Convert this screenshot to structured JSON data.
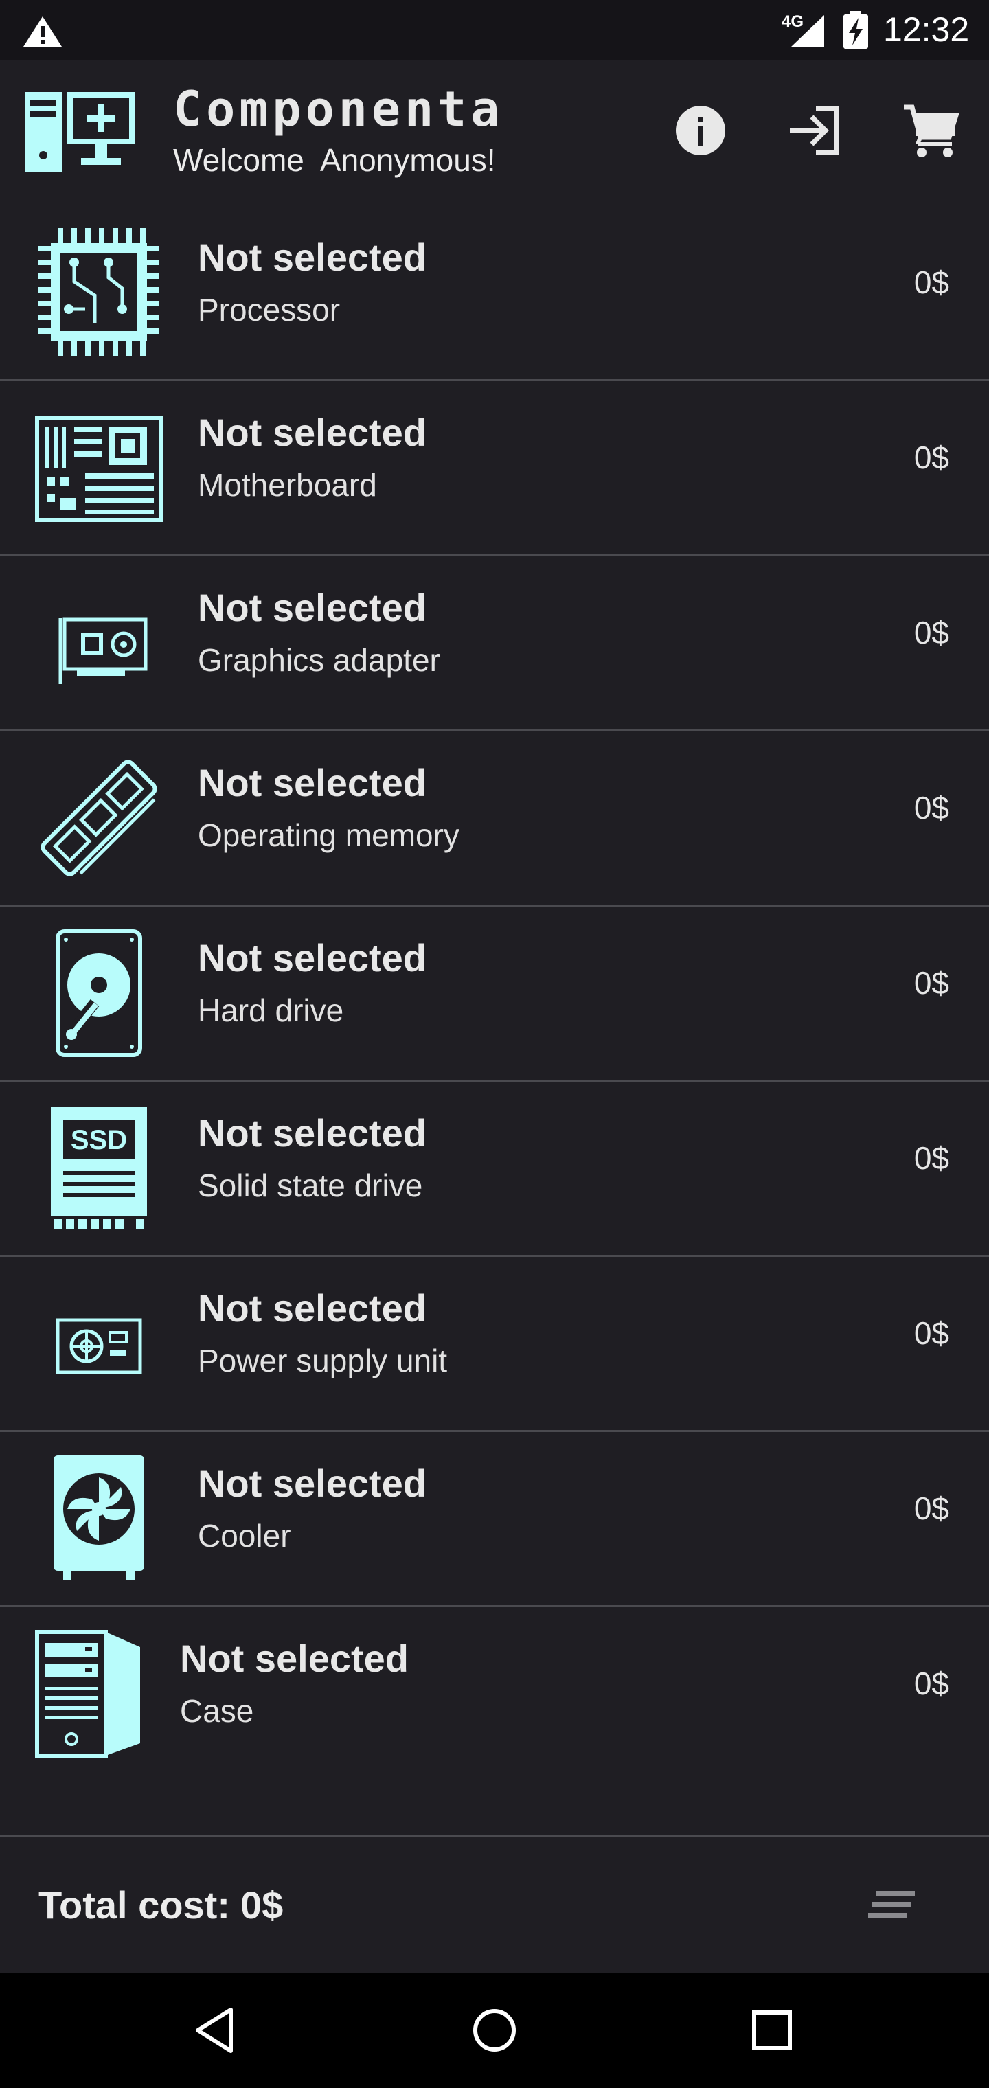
{
  "status_bar": {
    "network": "4G",
    "time": "12:32",
    "icons": [
      "warning-icon",
      "signal-icon",
      "battery-charging-icon"
    ]
  },
  "app_bar": {
    "title": "Componenta",
    "welcome": "Welcome  Anonymous!",
    "actions": [
      "info-icon",
      "login-icon",
      "cart-icon"
    ]
  },
  "components": [
    {
      "name": "Not selected",
      "type": "Processor",
      "price": "0$",
      "icon": "processor-icon"
    },
    {
      "name": "Not selected",
      "type": "Motherboard",
      "price": "0$",
      "icon": "motherboard-icon"
    },
    {
      "name": "Not selected",
      "type": "Graphics adapter",
      "price": "0$",
      "icon": "graphics-card-icon"
    },
    {
      "name": "Not selected",
      "type": "Operating memory",
      "price": "0$",
      "icon": "ram-icon"
    },
    {
      "name": "Not selected",
      "type": "Hard drive",
      "price": "0$",
      "icon": "hard-drive-icon"
    },
    {
      "name": "Not selected",
      "type": "Solid state drive",
      "price": "0$",
      "icon": "ssd-icon",
      "icon_text": "SSD"
    },
    {
      "name": "Not selected",
      "type": "Power supply unit",
      "price": "0$",
      "icon": "power-supply-icon"
    },
    {
      "name": "Not selected",
      "type": "Cooler",
      "price": "0$",
      "icon": "cooler-icon"
    },
    {
      "name": "Not selected",
      "type": "Case",
      "price": "0$",
      "icon": "case-icon"
    }
  ],
  "footer": {
    "total_label": "Total cost:",
    "total_value": "0$",
    "menu_icon": "sort-menu-icon"
  },
  "nav_bar": [
    "back-icon",
    "home-icon",
    "recents-icon"
  ],
  "colors": {
    "background": "#1f1e23",
    "accent_icon": "#b8fcfb",
    "divider": "#4a4a4f",
    "status_bar": "#151418",
    "nav_bar": "#000000"
  }
}
